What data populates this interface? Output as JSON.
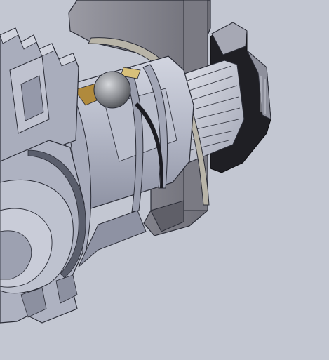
{
  "viewport": {
    "background": "#c3c7d2"
  },
  "colors": {
    "steel_light": "#bcc0cd",
    "steel_mid": "#9ea2b3",
    "steel_dark": "#6f7383",
    "edge": "#2a2c36",
    "bracket": "#8a8a93",
    "bracket_dark": "#5f5f68",
    "nut": "#1f1f24",
    "shim": "#b8b4a8",
    "ball": "#8d8f94",
    "brass": "#b08a3c"
  }
}
